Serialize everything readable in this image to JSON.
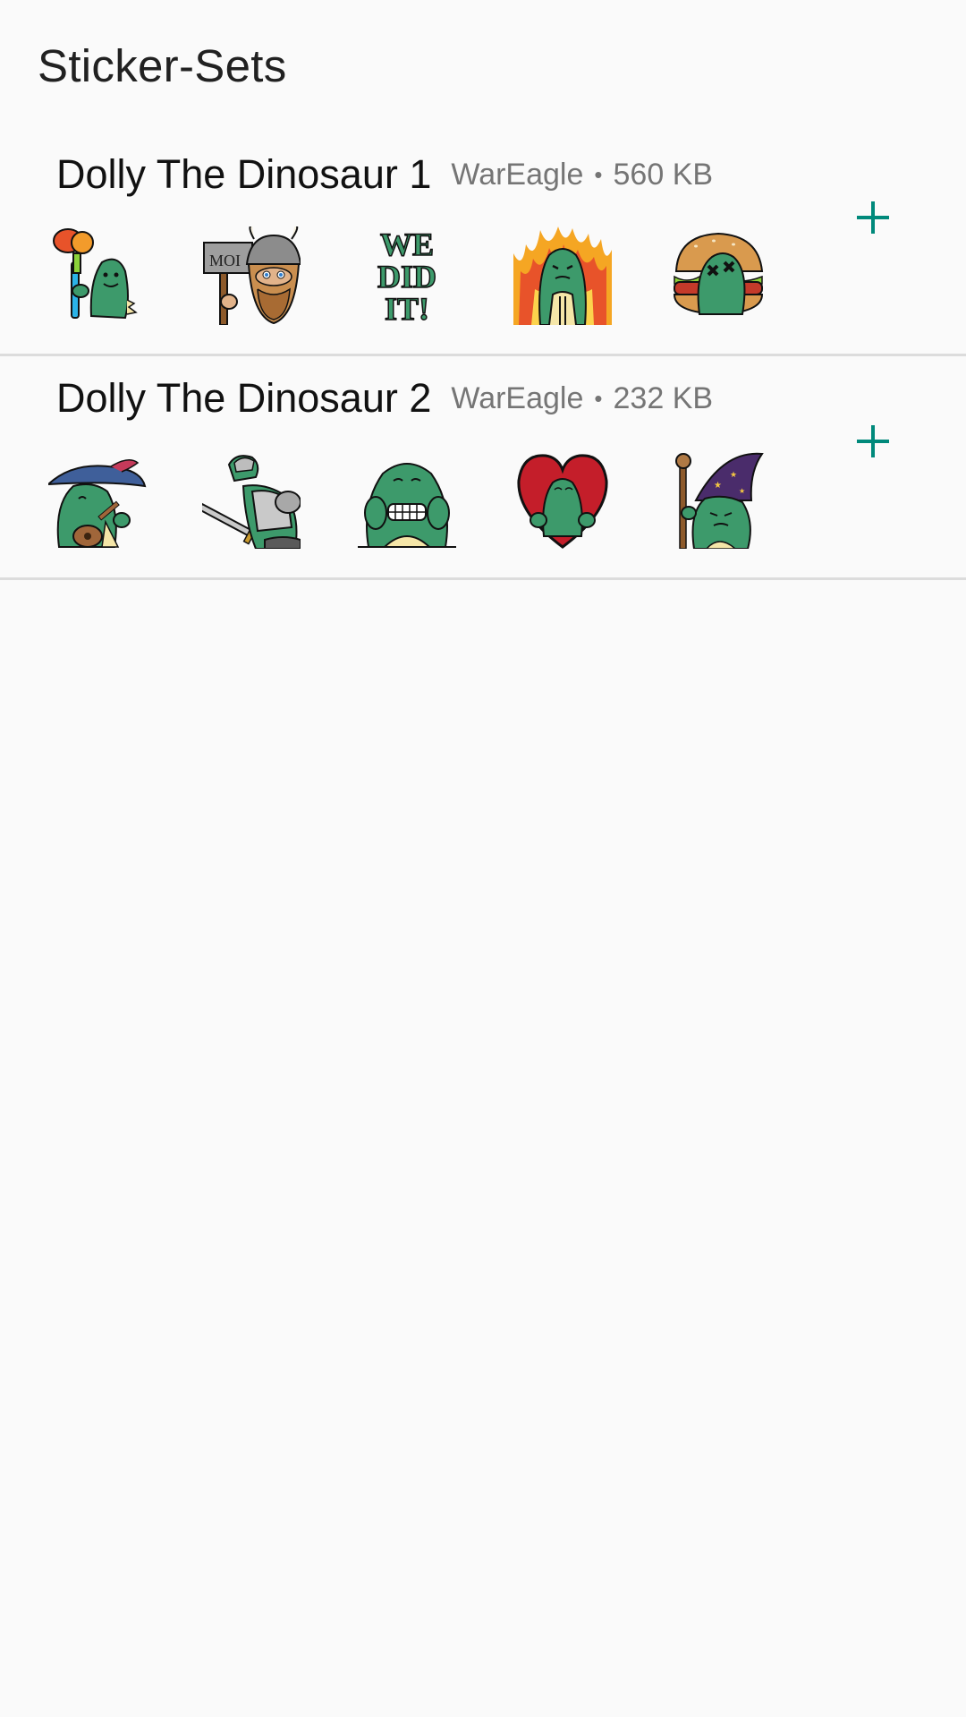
{
  "header": {
    "title": "Sticker-Sets"
  },
  "packs": [
    {
      "name": "Dolly The Dinosaur 1",
      "publisher": "WarEagle",
      "size": "560 KB",
      "separator": "•",
      "stickers": [
        "dino-hammer-sticker",
        "viking-sign-sticker",
        "we-did-it-sticker",
        "dino-fire-sticker",
        "dino-burger-sticker"
      ],
      "we_did_it_lines": [
        "WE",
        "DID",
        "IT!"
      ],
      "sign_text": "MOI"
    },
    {
      "name": "Dolly The Dinosaur 2",
      "publisher": "WarEagle",
      "size": "232 KB",
      "separator": "•",
      "stickers": [
        "dino-bard-sticker",
        "dino-knight-sticker",
        "dino-grimace-sticker",
        "dino-heart-sticker",
        "dino-wizard-sticker"
      ]
    }
  ],
  "colors": {
    "accent": "#00897b",
    "dino_green": "#3d9a6b",
    "divider": "#dcdcdc"
  },
  "icons": {
    "add": "plus-icon"
  }
}
